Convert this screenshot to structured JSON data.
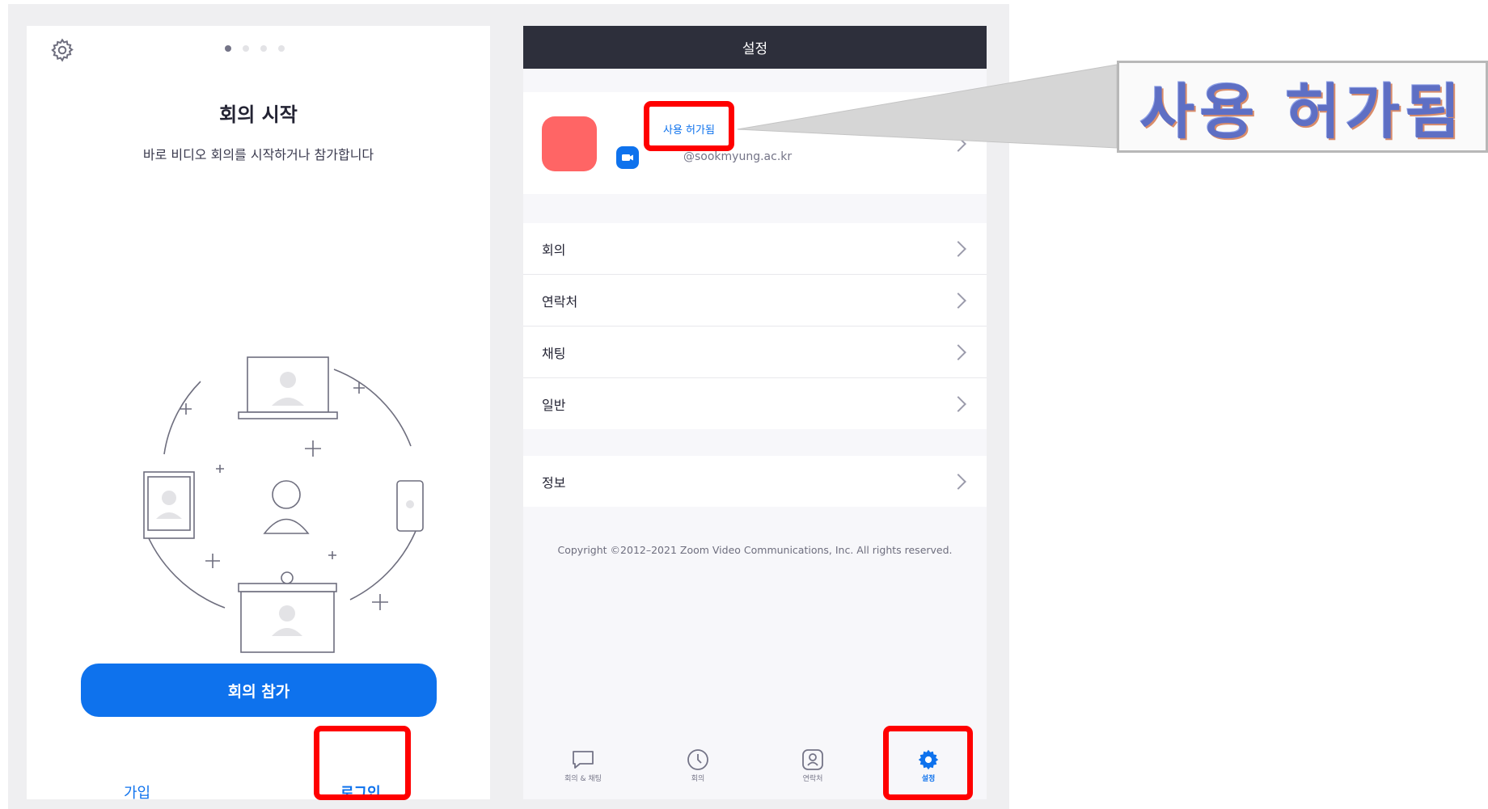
{
  "left_panel": {
    "title": "회의 시작",
    "subtitle": "바로 비디오 회의를 시작하거나 참가합니다",
    "join_button": "회의 참가",
    "signup_link": "가입",
    "login_link": "로그인",
    "carousel": {
      "pages": 4,
      "active_index": 0
    },
    "icons": {
      "settings": "gear-icon"
    }
  },
  "right_panel": {
    "header_title": "설정",
    "profile": {
      "license_status": "사용 허가됨",
      "email": "@sookmyung.ac.kr",
      "avatar_color": "#ff6565"
    },
    "menu_items": [
      {
        "label": "회의"
      },
      {
        "label": "연락처"
      },
      {
        "label": "채팅"
      },
      {
        "label": "일반"
      }
    ],
    "about_item": {
      "label": "정보"
    },
    "copyright": "Copyright ©2012–2021 Zoom Video Communications, Inc. All rights reserved.",
    "tabs": [
      {
        "label": "회의 & 채팅",
        "icon": "chat-icon"
      },
      {
        "label": "회의",
        "icon": "clock-icon"
      },
      {
        "label": "연락처",
        "icon": "contact-icon"
      },
      {
        "label": "설정",
        "icon": "gear-icon",
        "active": true
      }
    ]
  },
  "callout": {
    "text": "사용 허가됨"
  },
  "colors": {
    "accent": "#0e72ed",
    "header_bg": "#2d2f3b",
    "highlight": "#ff0000",
    "callout_text": "#5e6fc4"
  }
}
